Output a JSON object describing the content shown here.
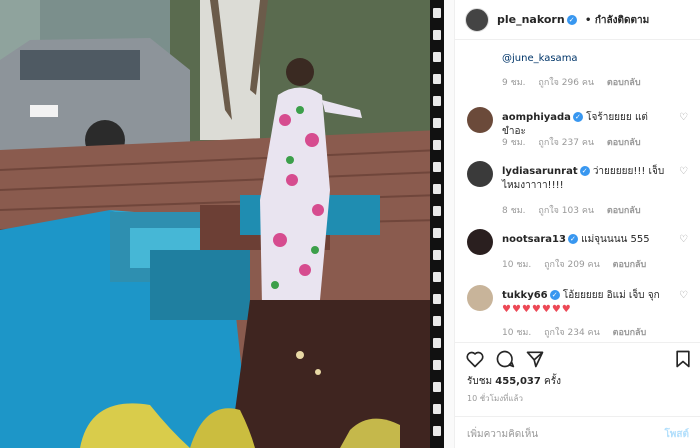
{
  "header": {
    "username": "ple_nakorn",
    "follow_status": "กำลังติดตาม"
  },
  "comments": {
    "first_mention": "@june_kasama",
    "first_meta": {
      "time": "9 ชม.",
      "likes": "ถูกใจ 296 คน",
      "reply": "ตอบกลับ"
    },
    "items": [
      {
        "user": "aomphiyada",
        "text": "โจร้ายยยย แต่ขำอะ",
        "time": "9 ชม.",
        "likes": "ถูกใจ 237 คน",
        "reply": "ตอบกลับ",
        "avatar_color": "#6b4a3a"
      },
      {
        "user": "lydiasarunrat",
        "text": "ว่ายยยยย!!! เจ็บไหมงาาาา!!!!",
        "time": "8 ชม.",
        "likes": "ถูกใจ 103 คน",
        "reply": "ตอบกลับ",
        "avatar_color": "#3a3a3a"
      },
      {
        "user": "nootsara13",
        "text": "แม่จุนนนน 555",
        "time": "10 ชม.",
        "likes": "ถูกใจ 209 คน",
        "reply": "ตอบกลับ",
        "avatar_color": "#2a1f1f"
      },
      {
        "user": "tukky66",
        "text": "โอ้ยยยยย อิแม่ เจ็บ จุก",
        "hearts": "♥♥♥♥♥♥♥",
        "time": "10 ชม.",
        "likes": "ถูกใจ 234 คน",
        "reply": "ตอบกลับ",
        "avatar_color": "#c8b49a"
      }
    ]
  },
  "stats": {
    "views_label": "รับชม",
    "views_count": "455,037",
    "views_suffix": "ครั้ง",
    "posted_ago": "10 ชั่วโมงที่แล้ว"
  },
  "add_comment": {
    "placeholder": "เพิ่มความคิดเห็น",
    "post_label": "โพสต์"
  },
  "icons": {
    "like": "heart-icon",
    "comment": "comment-icon",
    "share": "share-icon",
    "save": "bookmark-icon"
  },
  "colors": {
    "verified": "#3897f0",
    "link": "#003569",
    "heart": "#ed4956",
    "muted": "#999999"
  }
}
